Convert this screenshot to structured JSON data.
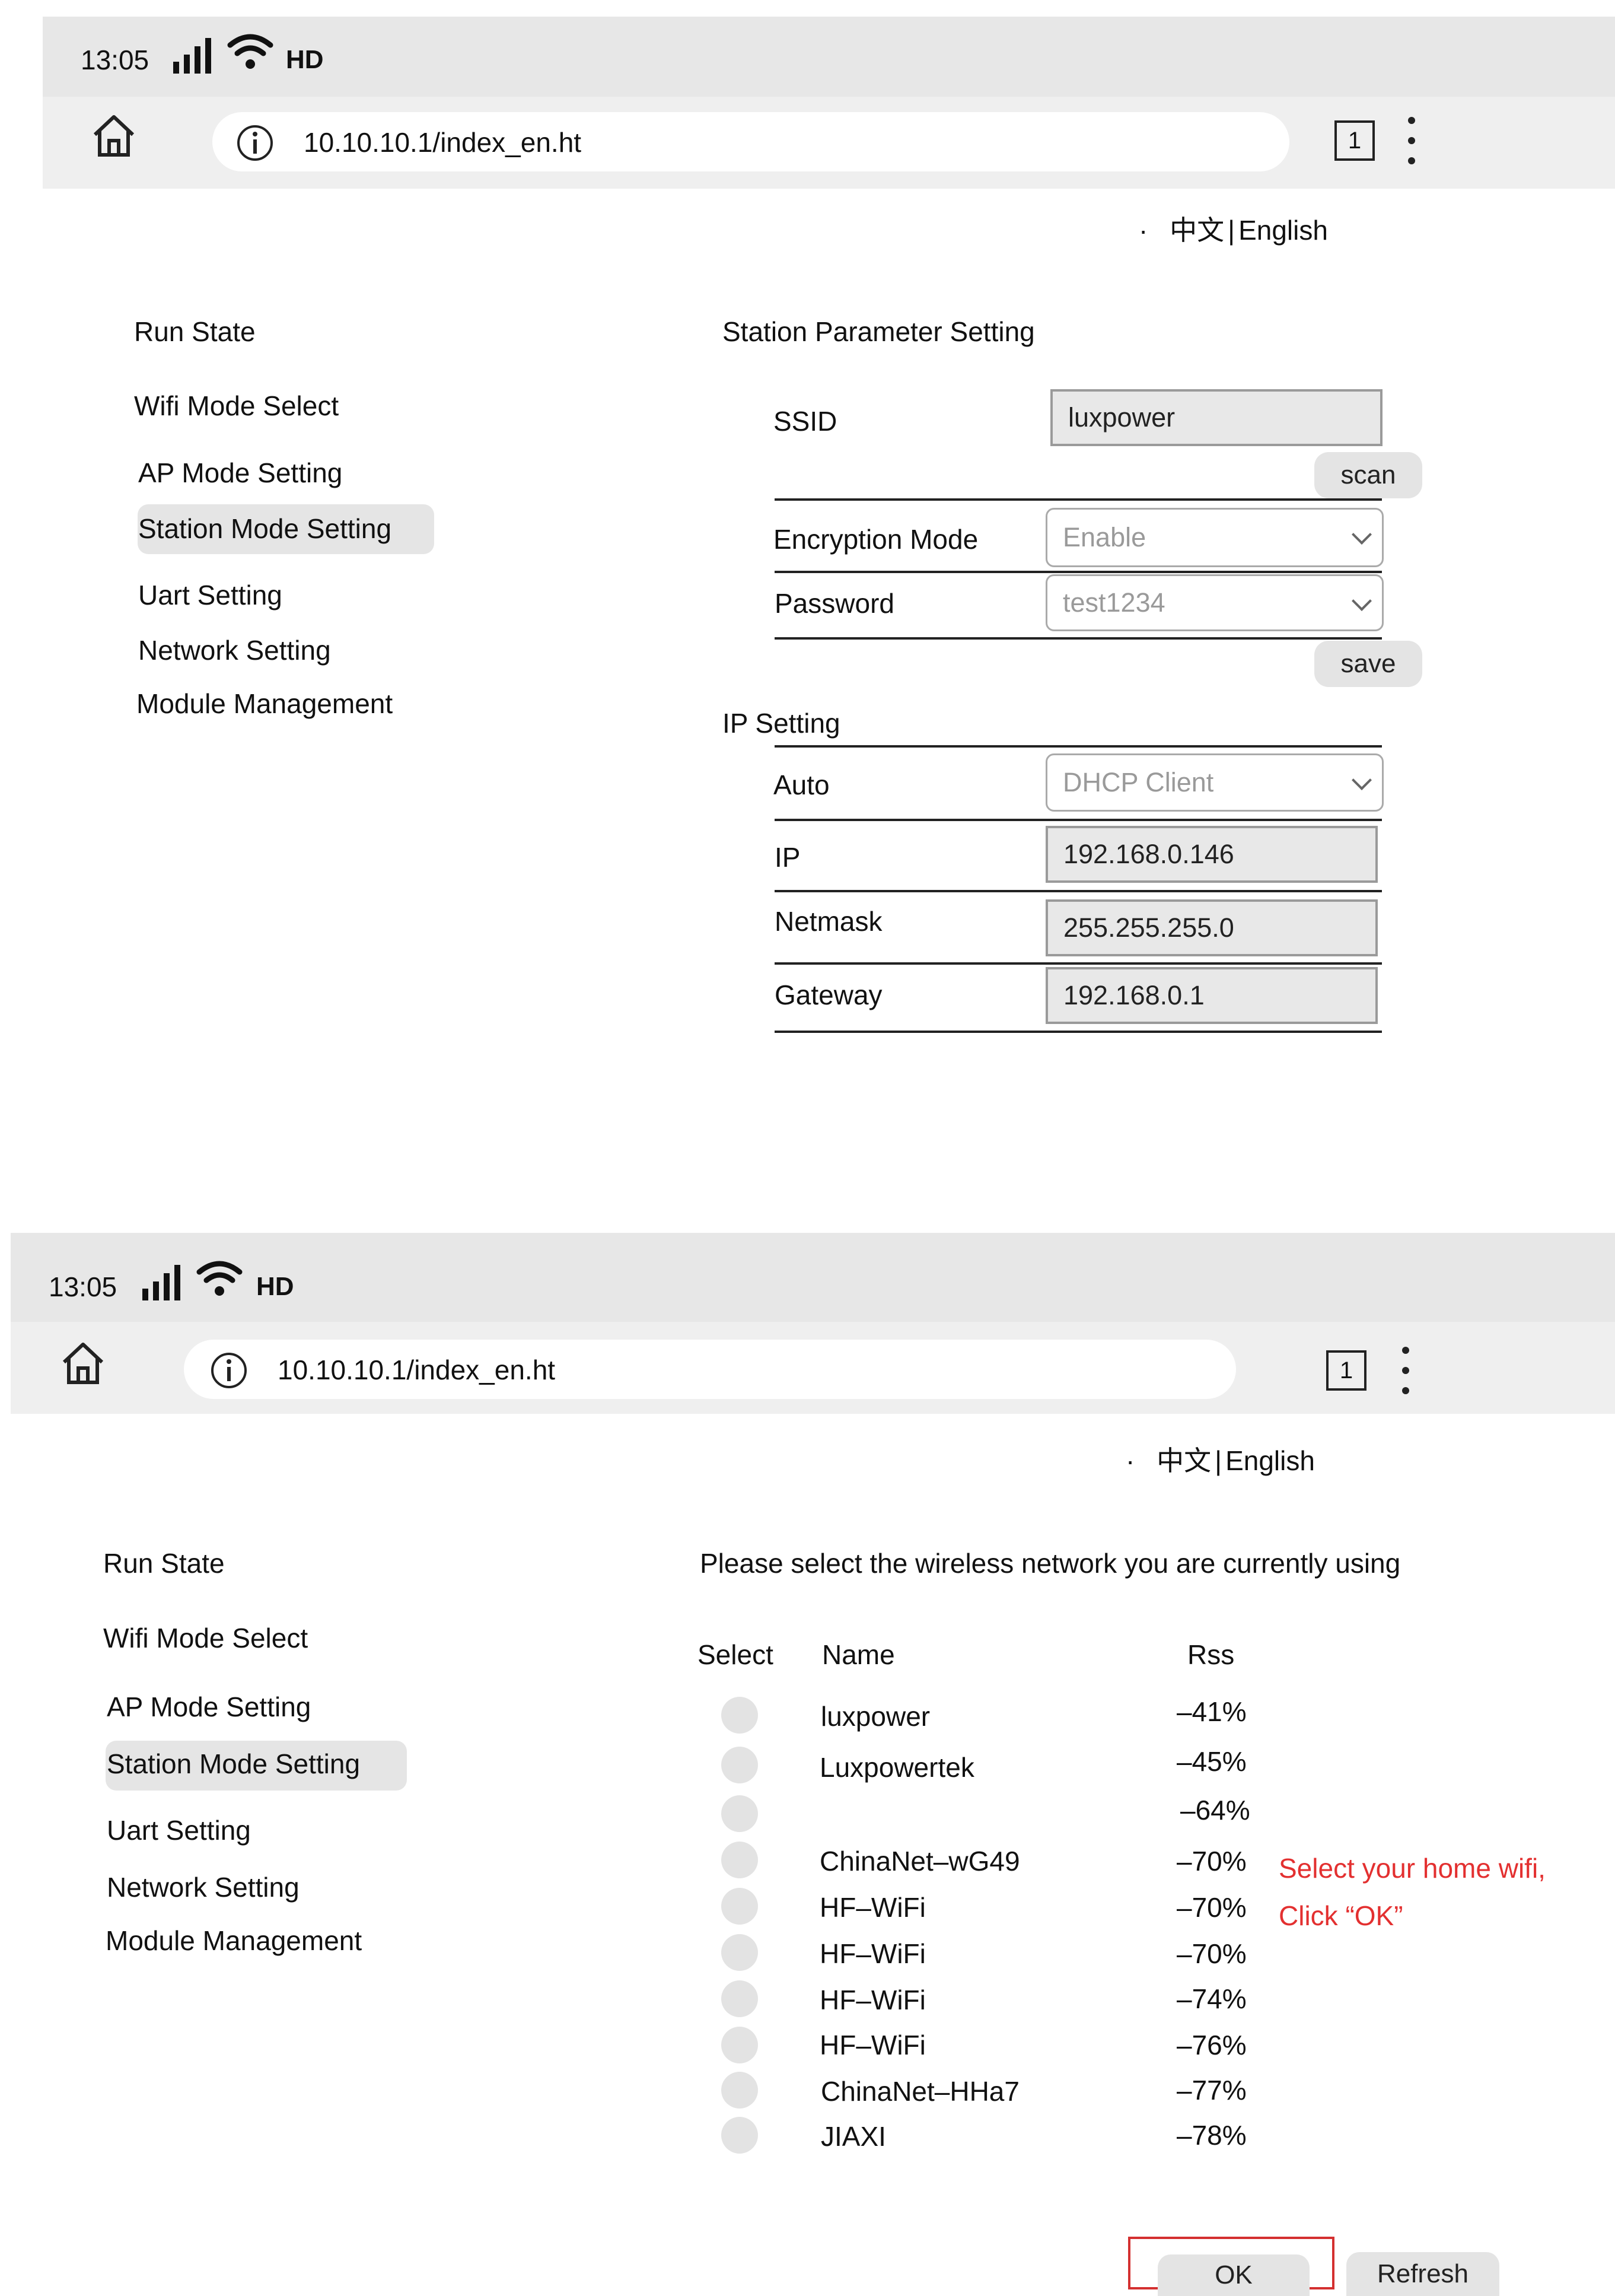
{
  "status": {
    "time": "13:05",
    "network": "HD"
  },
  "browser": {
    "url": "10.10.10.1/index_en.ht",
    "tab_count": "1"
  },
  "language": {
    "bullet": "·",
    "chinese": "中文",
    "separator": "|",
    "english": "English"
  },
  "sidebar": {
    "items": [
      {
        "label": "Run State"
      },
      {
        "label": "Wifi Mode Select"
      },
      {
        "label": "AP Mode Setting"
      },
      {
        "label": "Station Mode Setting",
        "active": true
      },
      {
        "label": "Uart Setting"
      },
      {
        "label": "Network Setting"
      },
      {
        "label": "Module Management"
      }
    ]
  },
  "station": {
    "title": "Station Parameter Setting",
    "ssid_label": "SSID",
    "ssid_value": "luxpower",
    "scan_label": "scan",
    "encryption_label": "Encryption Mode",
    "encryption_value": "Enable",
    "password_label": "Password",
    "password_value": "test1234",
    "save_label": "save"
  },
  "ip": {
    "title": "IP Setting",
    "auto_label": "Auto",
    "auto_value": "DHCP Client",
    "ip_label": "IP",
    "ip_value": "192.168.0.146",
    "netmask_label": "Netmask",
    "netmask_value": "255.255.255.0",
    "gateway_label": "Gateway",
    "gateway_value": "192.168.0.1"
  },
  "scan": {
    "prompt": "Please select the wireless network you are currently using",
    "col_select": "Select",
    "col_name": "Name",
    "col_rss": "Rss",
    "networks": [
      {
        "name": "luxpower",
        "rss": "–41%"
      },
      {
        "name": "Luxpowertek",
        "rss": "–45%"
      },
      {
        "name": "",
        "rss": "–64%"
      },
      {
        "name": "ChinaNet–wG49",
        "rss": "–70%"
      },
      {
        "name": "HF–WiFi",
        "rss": "–70%"
      },
      {
        "name": "HF–WiFi",
        "rss": "–70%"
      },
      {
        "name": "HF–WiFi",
        "rss": "–74%"
      },
      {
        "name": "HF–WiFi",
        "rss": "–76%"
      },
      {
        "name": "ChinaNet–HHa7",
        "rss": "–77%"
      },
      {
        "name": "JIAXI",
        "rss": "–78%"
      }
    ],
    "annotation_line1": "Select your home wifi,",
    "annotation_line2": "Click “OK”",
    "ok_label": "OK",
    "refresh_label": "Refresh",
    "annotation_color": "#e33030"
  }
}
